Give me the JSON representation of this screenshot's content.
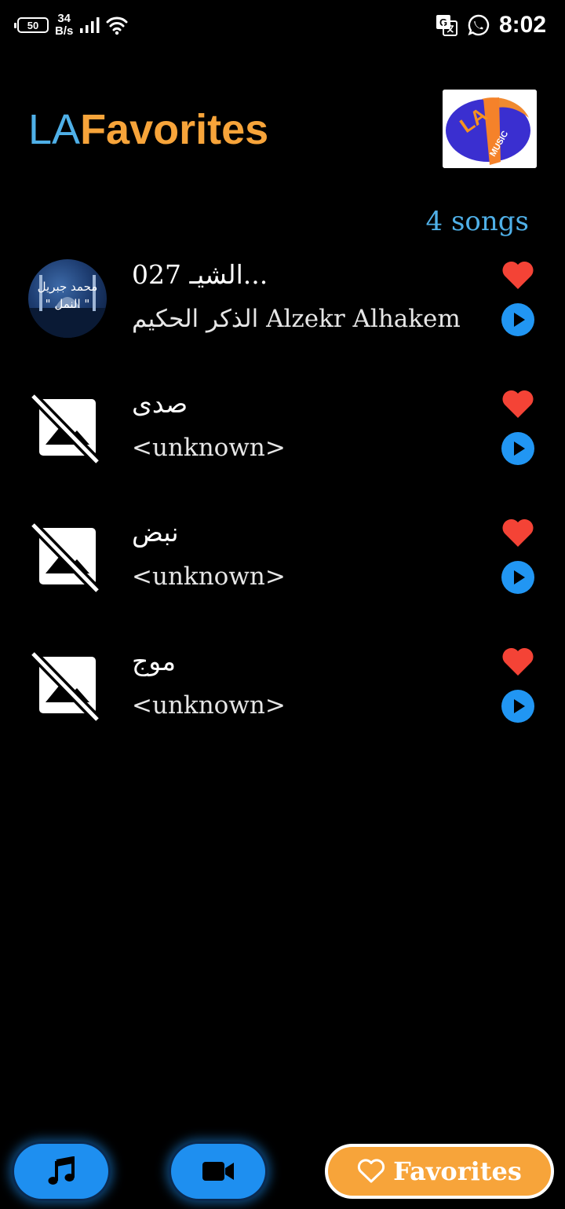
{
  "status_bar": {
    "battery": "50",
    "net_speed_value": "34",
    "net_speed_unit": "B/s",
    "time": "8:02"
  },
  "header": {
    "title_prefix": "LA",
    "title_main": "Favorites",
    "logo_text_top": "LA",
    "logo_text_bottom": "MUSIC"
  },
  "song_count": "4 songs",
  "songs": [
    {
      "title": "027 الشيـ...",
      "artist": "الذكر الحكيم Alzekr Alhakem",
      "art_line1": "محمد جبريل",
      "art_line2": "\" النمل \""
    },
    {
      "title": "صدى",
      "artist": "<unknown>"
    },
    {
      "title": "نبض",
      "artist": "<unknown>"
    },
    {
      "title": "موج",
      "artist": "<unknown>"
    }
  ],
  "bottom_nav": {
    "favorites_label": "Favorites"
  },
  "colors": {
    "accent_blue": "#4fb0e8",
    "accent_orange": "#f7a43a",
    "heart_red": "#f44336",
    "play_blue": "#2196f3"
  }
}
